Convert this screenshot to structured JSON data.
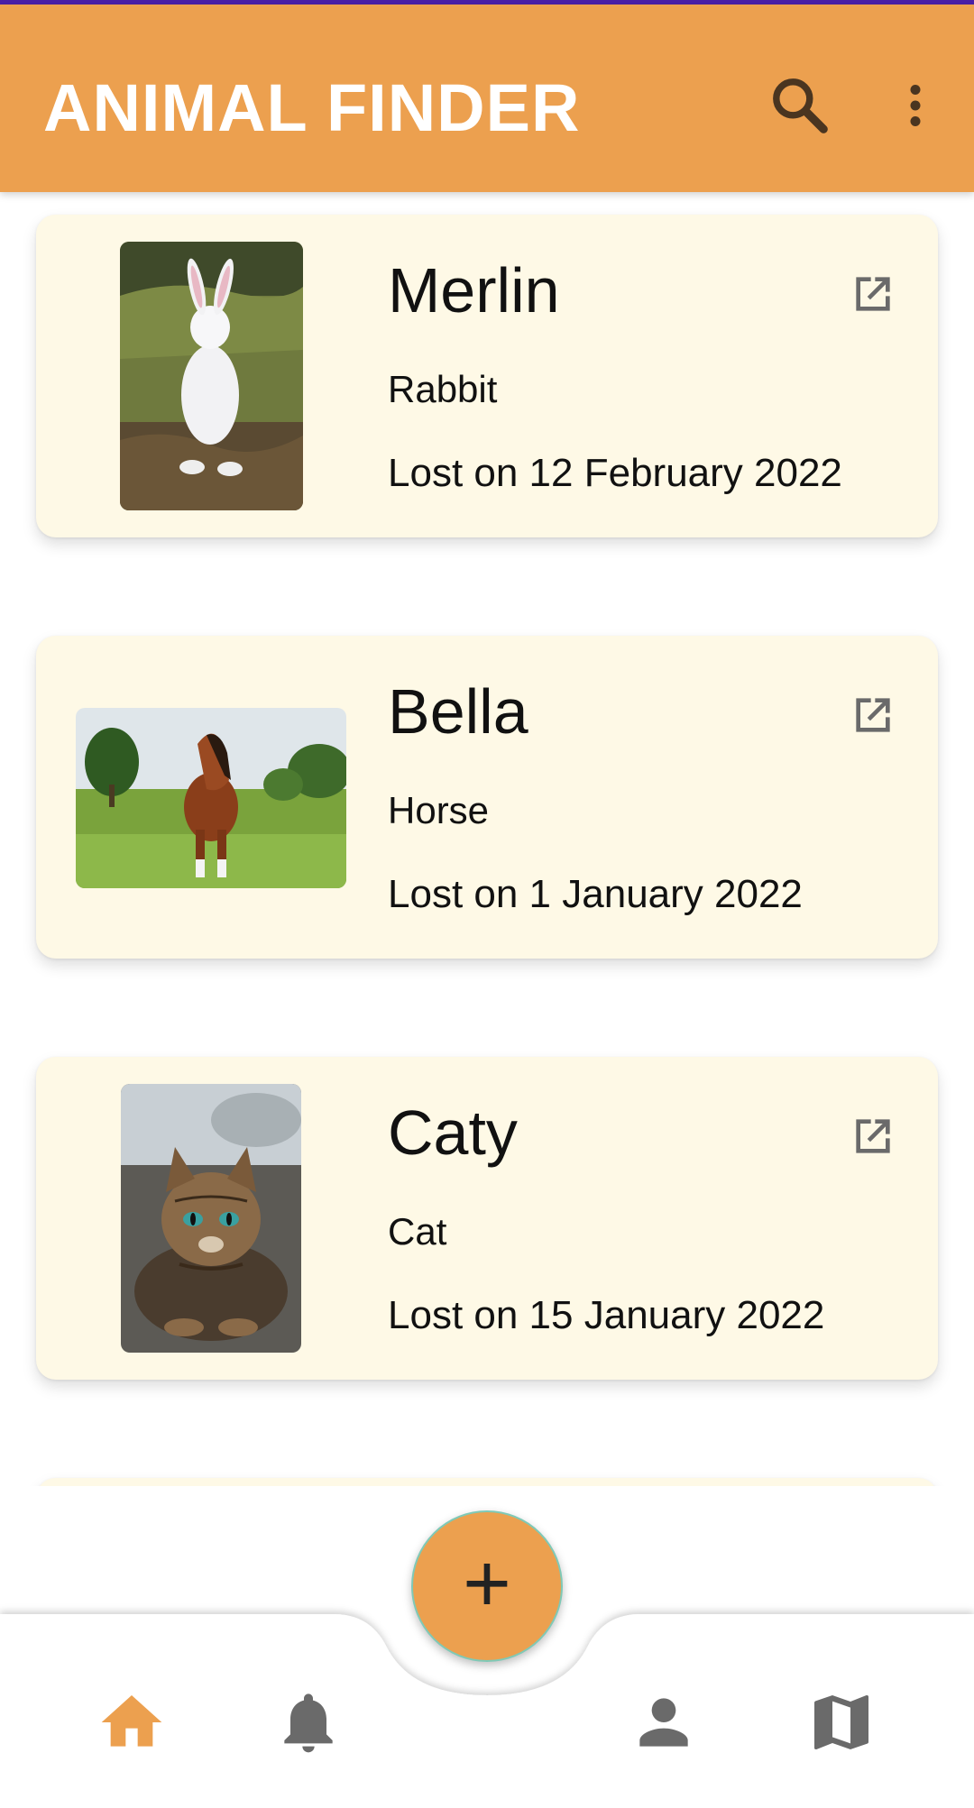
{
  "app": {
    "title": "ANIMAL FINDER",
    "accent": "#eca04f",
    "card_bg": "#fef9e6"
  },
  "toolbar": {
    "search_icon": "search-icon",
    "more_icon": "more-vert-icon"
  },
  "animals": [
    {
      "name": "Merlin",
      "species": "Rabbit",
      "lost": "Lost on 12 February 2022",
      "icon": "open-in-new-icon"
    },
    {
      "name": "Bella",
      "species": "Horse",
      "lost": "Lost on 1 January 2022",
      "icon": "open-in-new-icon"
    },
    {
      "name": "Caty",
      "species": "Cat",
      "lost": "Lost on 15 January 2022",
      "icon": "open-in-new-icon"
    }
  ],
  "fab": {
    "label": "+",
    "icon": "add-icon"
  },
  "nav": [
    {
      "id": "home",
      "icon": "home-icon",
      "active": true
    },
    {
      "id": "notifications",
      "icon": "bell-icon",
      "active": false
    },
    {
      "id": "profile",
      "icon": "person-icon",
      "active": false
    },
    {
      "id": "map",
      "icon": "map-icon",
      "active": false
    }
  ]
}
